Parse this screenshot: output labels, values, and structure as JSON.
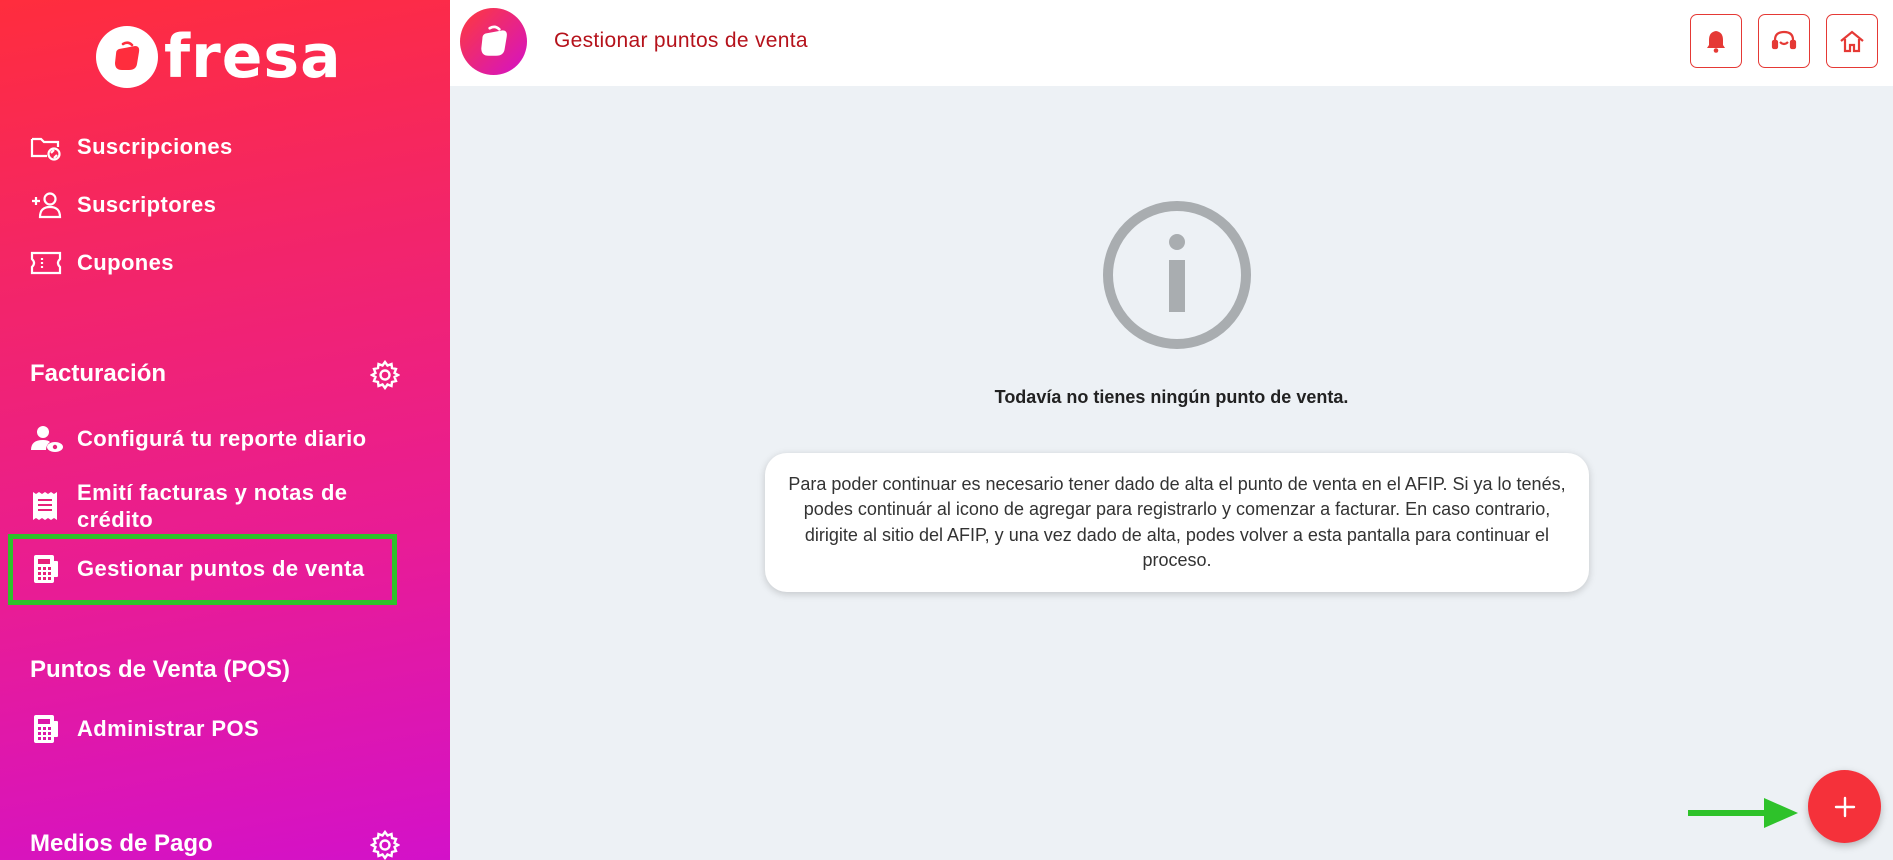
{
  "brand": {
    "name": "fresa"
  },
  "sidebar": {
    "items": [
      {
        "label": "Suscripciones",
        "icon": "folder-sync-icon"
      },
      {
        "label": "Suscriptores",
        "icon": "add-user-icon"
      },
      {
        "label": "Cupones",
        "icon": "ticket-icon"
      }
    ],
    "facturacion": {
      "title": "Facturación",
      "items": [
        {
          "label": "Configurá tu reporte diario",
          "icon": "user-eye-icon"
        },
        {
          "label": "Emití facturas y notas de crédito",
          "icon": "receipt-icon"
        },
        {
          "label": "Gestionar puntos de venta",
          "icon": "register-icon"
        }
      ]
    },
    "pos": {
      "title": "Puntos de Venta (POS)",
      "items": [
        {
          "label": "Administrar POS",
          "icon": "register-icon"
        }
      ]
    },
    "medios_pago": {
      "title": "Medios de Pago"
    }
  },
  "header": {
    "title": "Gestionar puntos de venta",
    "buttons": [
      "bell-icon",
      "support-headset-icon",
      "home-icon"
    ]
  },
  "main": {
    "empty_title": "Todavía no tienes ningún punto de venta.",
    "info_text": "Para poder continuar es necesario tener dado de alta el punto de venta en el AFIP. Si ya lo tenés, podes continuár al icono de agregar para registrarlo y comenzar a facturar. En caso contrario, dirigite al sitio del AFIP, y una vez dado de alta, podes volver a esta pantalla para continuar el proceso.",
    "fab_label": "+"
  },
  "colors": {
    "accent": "#f5313a",
    "title_red": "#b5121b",
    "highlight": "#2ec22a",
    "sidebar_top": "#ff2d3d",
    "sidebar_bottom": "#d311c9"
  }
}
